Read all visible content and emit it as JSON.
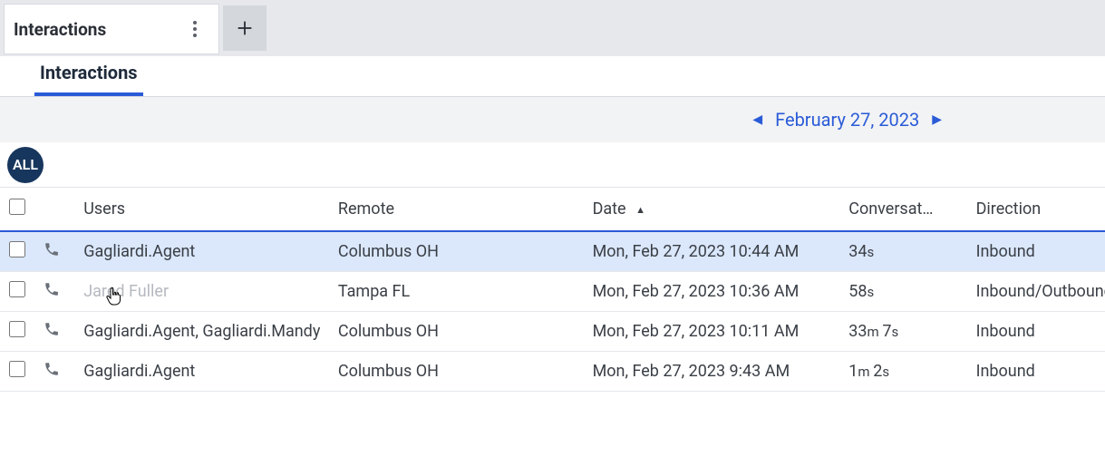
{
  "topTab": {
    "title": "Interactions"
  },
  "subTab": {
    "label": "Interactions"
  },
  "dateNav": {
    "label": "February 27, 2023"
  },
  "filterBadge": {
    "label": "ALL"
  },
  "columns": {
    "users": "Users",
    "remote": "Remote",
    "date": "Date",
    "conversation": "Conversat…",
    "direction": "Direction"
  },
  "rows": [
    {
      "selected": true,
      "users": "Gagliardi.Agent",
      "dimUsers": false,
      "remote": "Columbus OH",
      "date": "Mon, Feb 27, 2023 10:44 AM",
      "durMain": "34",
      "durUnit": "s",
      "dur2Main": "",
      "dur2Unit": "",
      "direction": "Inbound"
    },
    {
      "selected": false,
      "users": "Jared Fuller",
      "dimUsers": true,
      "remote": "Tampa FL",
      "date": "Mon, Feb 27, 2023 10:36 AM",
      "durMain": "58",
      "durUnit": "s",
      "dur2Main": "",
      "dur2Unit": "",
      "direction": "Inbound/Outbound"
    },
    {
      "selected": false,
      "users": "Gagliardi.Agent, Gagliardi.Mandy",
      "dimUsers": false,
      "remote": "Columbus OH",
      "date": "Mon, Feb 27, 2023 10:11 AM",
      "durMain": "33",
      "durUnit": "m ",
      "dur2Main": "7",
      "dur2Unit": "s",
      "direction": "Inbound"
    },
    {
      "selected": false,
      "users": "Gagliardi.Agent",
      "dimUsers": false,
      "remote": "Columbus OH",
      "date": "Mon, Feb 27, 2023 9:43 AM",
      "durMain": "1",
      "durUnit": "m ",
      "dur2Main": "2",
      "dur2Unit": "s",
      "direction": "Inbound"
    }
  ]
}
